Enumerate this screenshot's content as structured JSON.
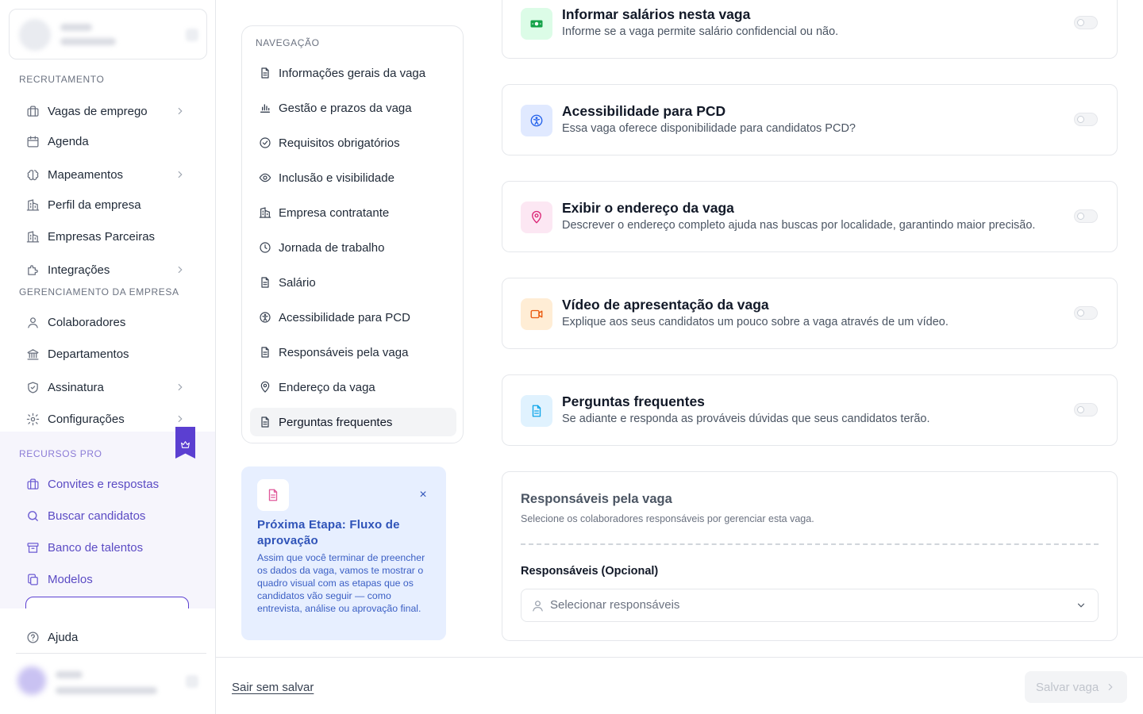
{
  "sidebar": {
    "sections": {
      "recruitment": "RECRUTAMENTO",
      "company_management": "GERENCIAMENTO DA EMPRESA",
      "pro_resources": "RECURSOS PRO"
    },
    "items": [
      {
        "label": "Vagas de emprego",
        "icon": "briefcase-icon",
        "has_submenu": true
      },
      {
        "label": "Agenda",
        "icon": "calendar-icon",
        "has_submenu": false
      },
      {
        "label": "Mapeamentos",
        "icon": "brain-icon",
        "has_submenu": true
      },
      {
        "label": "Perfil da empresa",
        "icon": "building-icon",
        "has_submenu": false
      },
      {
        "label": "Empresas Parceiras",
        "icon": "building-icon",
        "has_submenu": false
      },
      {
        "label": "Integrações",
        "icon": "puzzle-icon",
        "has_submenu": true
      },
      {
        "label": "Colaboradores",
        "icon": "user-icon",
        "has_submenu": false
      },
      {
        "label": "Departamentos",
        "icon": "bank-icon",
        "has_submenu": false
      },
      {
        "label": "Assinatura",
        "icon": "shield-icon",
        "has_submenu": true
      },
      {
        "label": "Configurações",
        "icon": "gear-icon",
        "has_submenu": true
      }
    ],
    "pro_items": [
      {
        "label": "Convites e respostas",
        "icon": "briefcase-icon"
      },
      {
        "label": "Buscar candidatos",
        "icon": "search-icon"
      },
      {
        "label": "Banco de talentos",
        "icon": "archive-icon"
      },
      {
        "label": "Modelos",
        "icon": "copy-icon"
      }
    ],
    "help": {
      "label": "Ajuda",
      "icon": "help-icon"
    }
  },
  "navigation": {
    "title": "NAVEGAÇÃO",
    "items": [
      {
        "label": "Informações gerais da vaga",
        "icon": "document-icon"
      },
      {
        "label": "Gestão e prazos da vaga",
        "icon": "bar-chart-icon"
      },
      {
        "label": "Requisitos obrigatórios",
        "icon": "check-circle-icon"
      },
      {
        "label": "Inclusão e visibilidade",
        "icon": "eye-icon"
      },
      {
        "label": "Empresa contratante",
        "icon": "building-icon"
      },
      {
        "label": "Jornada de trabalho",
        "icon": "clock-icon"
      },
      {
        "label": "Salário",
        "icon": "document-icon"
      },
      {
        "label": "Acessibilidade para PCD",
        "icon": "accessibility-icon"
      },
      {
        "label": "Responsáveis pela vaga",
        "icon": "document-icon"
      },
      {
        "label": "Endereço da vaga",
        "icon": "map-pin-icon"
      },
      {
        "label": "Perguntas frequentes",
        "icon": "document-icon",
        "active": true
      }
    ]
  },
  "tip": {
    "title": "Próxima Etapa: Fluxo de aprovação",
    "body": "Assim que você terminar de preencher os dados da vaga, vamos te mostrar o quadro visual com as etapas que os candidatos vão seguir — como entrevista, análise ou aprovação final.",
    "close_symbol": "×"
  },
  "options": [
    {
      "title": "Informar salários nesta vaga",
      "desc": "Informe se a vaga permite salário confidencial ou não.",
      "icon": "money-icon",
      "icon_color": "#16a34a",
      "icon_bg": "#dcfce7",
      "enabled": false
    },
    {
      "title": "Acessibilidade para PCD",
      "desc": "Essa vaga oferece disponibilidade para candidatos PCD?",
      "icon": "accessibility-icon",
      "icon_color": "#2563eb",
      "icon_bg": "#e0e9ff",
      "enabled": false
    },
    {
      "title": "Exibir o endereço da vaga",
      "desc": "Descrever o endereço completo ajuda nas buscas por localidade, garantindo maior precisão.",
      "icon": "map-pin-icon",
      "icon_color": "#db2777",
      "icon_bg": "#fce7f3",
      "enabled": false
    },
    {
      "title": "Vídeo de apresentação da vaga",
      "desc": "Explique aos seus candidatos um pouco sobre a vaga através de um vídeo.",
      "icon": "video-icon",
      "icon_color": "#ea580c",
      "icon_bg": "#ffedd5",
      "enabled": false
    },
    {
      "title": "Perguntas frequentes",
      "desc": "Se adiante e responda as prováveis dúvidas que seus candidatos terão.",
      "icon": "document-icon",
      "icon_color": "#0ea5e9",
      "icon_bg": "#e0f2fe",
      "enabled": false
    }
  ],
  "responsibles": {
    "title": "Responsáveis pela vaga",
    "subtitle": "Selecione os colaboradores responsáveis por gerenciar esta vaga.",
    "field_label": "Responsáveis (Opcional)",
    "placeholder": "Selecionar responsáveis"
  },
  "footer": {
    "exit_label": "Sair sem salvar",
    "save_label": "Salvar vaga"
  },
  "colors": {
    "accent": "#5b3fd1",
    "tip_text": "#2f53b8"
  }
}
